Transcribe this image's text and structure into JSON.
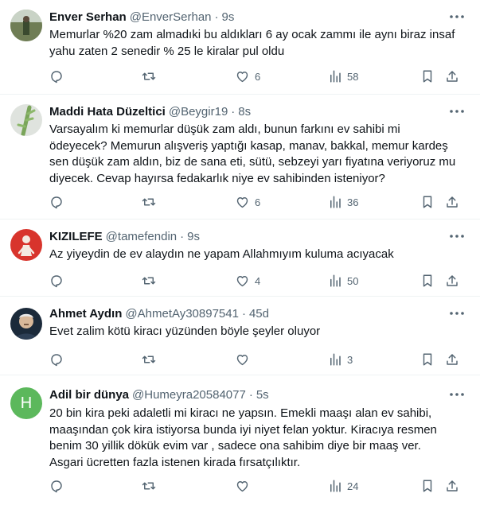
{
  "colors": {
    "text": "#0f1419",
    "muted": "#536471",
    "divider": "#eff3f4",
    "h_avatar": "#5cb85c"
  },
  "icons": [
    "more-icon",
    "reply-icon",
    "retweet-icon",
    "like-icon",
    "views-icon",
    "bookmark-icon",
    "share-icon"
  ],
  "tweets": [
    {
      "name": "Enver Serhan",
      "handle": "@EnverSerhan",
      "sep": "·",
      "time": "9s",
      "lines": [
        "Memurlar %20 zam almadıki bu aldıkları 6 ay ocak zammı ile aynı biraz insaf",
        "yahu zaten 2 senedir % 25 le kiralar pul oldu"
      ],
      "likes": "6",
      "views": "58"
    },
    {
      "name": "Maddi Hata Düzeltici",
      "handle": "@Beygir19",
      "sep": "·",
      "time": "8s",
      "lines": [
        "Varsayalım ki memurlar düşük zam aldı, bunun farkını ev sahibi mi",
        "ödeyecek? Memurun alışveriş yaptığı kasap, manav, bakkal, memur kardeş",
        "sen düşük zam aldın, biz de sana eti, sütü, sebzeyi yarı fiyatına veriyoruz mu",
        "diyecek. Cevap hayırsa fedakarlık niye ev sahibinden isteniyor?"
      ],
      "likes": "6",
      "views": "36"
    },
    {
      "name": "KIZILEFE",
      "handle": "@tamefendin",
      "sep": "·",
      "time": "9s",
      "lines": [
        "Az yiyeydin de ev alaydın ne yapam Allahmıyım kuluma acıyacak"
      ],
      "likes": "4",
      "views": "50"
    },
    {
      "name": "Ahmet Aydın",
      "handle": "@AhmetAy30897541",
      "sep": "·",
      "time": "45d",
      "lines": [
        "Evet zalim kötü kiracı yüzünden böyle şeyler oluyor"
      ],
      "likes": "",
      "views": "3"
    },
    {
      "name": "Adil bir dünya",
      "handle": "@Humeyra20584077",
      "sep": "·",
      "time": "5s",
      "avatar_letter": "H",
      "lines": [
        "20 bin kira peki adaletli mi kiracı ne yapsın. Emekli maaşı alan ev sahibi,",
        "maaşından çok kira istiyorsa bunda iyi niyet felan yoktur. Kiracıya resmen",
        "benim 30 yillik dökük evim var , sadece ona sahibim diye bir maaş ver.",
        "Asgari ücretten fazla istenen kirada fırsatçılıktır."
      ],
      "likes": "",
      "views": "24"
    }
  ]
}
